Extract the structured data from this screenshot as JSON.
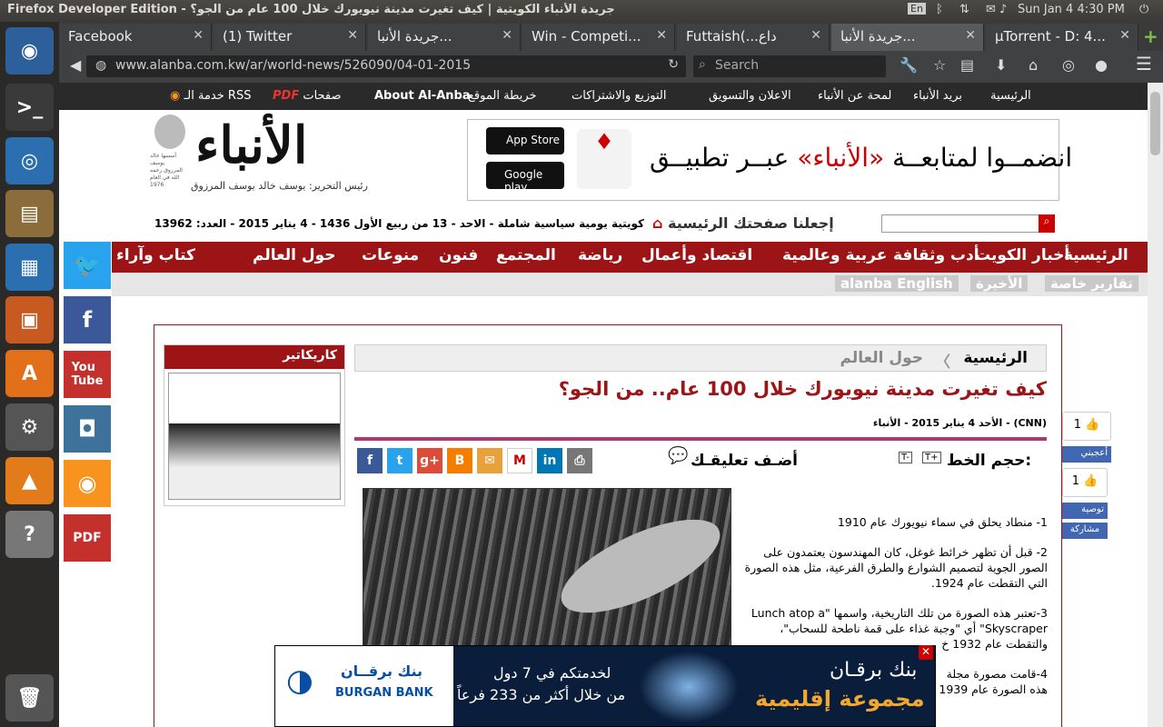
{
  "system": {
    "window_title": "Firefox Developer Edition - جريدة الأنباء الكويتية | كيف تغيرت مدينة نيويورك خلال 100 عام من الجو؟",
    "keyboard": "En",
    "clock": "Sun Jan  4  4:30 PM"
  },
  "tabs": [
    {
      "label": "Facebook"
    },
    {
      "label": "(1) Twitter"
    },
    {
      "label": "جريدة الأنبا..."
    },
    {
      "label": "Win - Competi..."
    },
    {
      "label": "Futtaish(...داع"
    },
    {
      "label": "جريدة الأنبا..."
    },
    {
      "label": "µTorrent - D: 4..."
    }
  ],
  "navbar": {
    "url": "www.alanba.com.kw/ar/world-news/526090/04-01-2015",
    "search_placeholder": "Search"
  },
  "topnav": [
    "الرئيسية",
    "بريد الأنباء",
    "لمحة عن الأنباء",
    "الاعلان والتسويق",
    "التوزيع والاشتراكات",
    "خريطة الموقع",
    "About Al-Anba",
    "صفحات",
    "خدمة الـ RSS"
  ],
  "logo": {
    "name": "الأنباء",
    "editor": "رئيس التحرير: يوسف خالد يوسف المرزوق",
    "founder": "أسسها خالد يوسف المرزوق رحمه الله في العام 1976"
  },
  "banner": {
    "text_black": "انضمــوا لمتابعــة",
    "text_red": "«الأنباء»",
    "text_black2": "عبــر تطبيــق",
    "appstore": "App Store",
    "googleplay": "Google play"
  },
  "infoline": {
    "date": "كويتية يومية سياسية شاملة - الاحد - 13 من ربيع الأول 1436 - 4 يناير 2015 - العدد: 13962",
    "homepage": "إجعلنا صفحتك الرئيسية"
  },
  "mainnav": [
    "الرئيسية",
    "أخبار الكويت",
    "أدب وثقافة",
    "عربية وعالمية",
    "اقتصاد وأعمال",
    "رياضة",
    "المجتمع",
    "فنون",
    "منوعات",
    "حول العالم",
    "كتاب وآراء"
  ],
  "subnav": [
    "تقارير خاصة",
    "الأخيرة",
    "alanba English"
  ],
  "social": [
    "Twitter",
    "Facebook",
    "YouTube",
    "Instagram",
    "RSS",
    "PDF"
  ],
  "cartoon": {
    "title": "كاريكاتير"
  },
  "breadcrumb": {
    "home": "الرئيسية",
    "section": "حول العالم"
  },
  "article": {
    "headline": "كيف تغيرت مدينة نيويورك خلال 100 عام.. من الجو؟",
    "dateline": "الأحد 4 يناير 2015 - الأنباء - (CNN)",
    "fontsize_label": "حجم الخط:",
    "comment_label": "أضـف تعليقـك",
    "paragraphs": [
      "1- منطاد يحلق في سماء نيويورك عام 1910",
      "2- قبل أن تظهر خرائط غوغل، كان المهندسون يعتمدون على الصور الجوية لتصميم الشوارع والطرق الفرعية، مثل هذه الصورة التي التقطت عام 1924.",
      "3-تعتبر هذه الصورة من تلك التاريخية، واسمها \"Lunch atop a Skyscraper\" أي \"وجبة غذاء على قمة ناطحة للسحاب\"، والتقطت عام 1932 خ",
      "4-قامت مصورة مجلة",
      "هذه الصورة عام 1939"
    ]
  },
  "likes": {
    "fb_count": "1",
    "fb_label": "أعجبني",
    "rec_count": "1",
    "rec_label": "توصية",
    "share_label": "مشاركة"
  },
  "ad": {
    "bank_ar": "بنك برقــان",
    "bank_en": "BURGAN BANK",
    "line1": "لخدمتكم في 7 دول",
    "line2": "من خلال أكثر من 233 فرعاً",
    "brand": "بنك برقـان",
    "slogan": "مجموعة إقليمية"
  }
}
